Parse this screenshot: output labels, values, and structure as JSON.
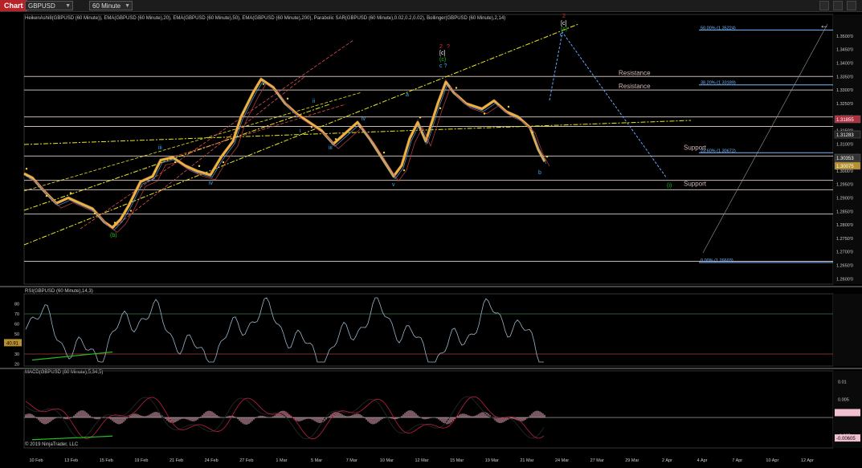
{
  "toolbar": {
    "chart_tab": "Chart",
    "instrument": "GBPUSD",
    "timeframe": "60 Minute"
  },
  "panels": {
    "price_title": "HeikenAshi8(GBPUSD (60 Minute)), EMA(GBPUSD (60 Minute),20), EMA(GBPUSD (60 Minute),50), EMA(GBPUSD (60 Minute),200), Parabolic SAR(GBPUSD (60 Minute),0.02,0.2,0.02), Bollinger(GBPUSD (60 Minute),2,14)",
    "rsi_title": "RSI(GBPUSD (60 Minute),14,3)",
    "macd_title": "MACD(GBPUSD (60 Minute),5,34,5)",
    "copyright": "© 2019 NinjaTrader, LLC"
  },
  "colors": {
    "background": "#000000",
    "candle": "#f0b040",
    "trend_yellow": "#e8e820",
    "trend_red": "#e05050",
    "level_line": "#e8d8d0",
    "fib_line": "#7ab8ff",
    "projection": "#6aa6ff",
    "rsi_line": "#9ab4c8",
    "macd_hist": "#f0b0c0",
    "green_line": "#20c020"
  },
  "chart_data": {
    "type": "line",
    "x_axis_labels": [
      "10 Feb",
      "13 Feb",
      "15 Feb",
      "19 Feb",
      "21 Feb",
      "24 Feb",
      "27 Feb",
      "1 Mar",
      "5 Mar",
      "7 Mar",
      "10 Mar",
      "12 Mar",
      "15 Mar",
      "19 Mar",
      "21 Mar",
      "24 Mar",
      "27 Mar",
      "29 Mar",
      "2 Apr",
      "4 Apr",
      "7 Apr",
      "10 Apr",
      "12 Apr"
    ],
    "price_axis_ticks": [
      "1.3500'0",
      "1.3450'0",
      "1.3400'0",
      "1.3350'0",
      "1.3300'0",
      "1.3250'0",
      "1.3200'0",
      "1.3150'0",
      "1.3100'0",
      "1.3050'0",
      "1.3000'0",
      "1.2950'0",
      "1.2900'0",
      "1.2850'0",
      "1.2800'0",
      "1.2750'0",
      "1.2700'0",
      "1.2650'0",
      "1.2600'0"
    ],
    "price_axis_range": [
      1.258,
      1.358
    ],
    "price_tags": [
      "1.31855",
      "1.31283",
      "1.30353",
      "1.30075"
    ],
    "horizontal_levels": [
      1.335,
      1.33,
      1.32,
      1.3165,
      1.3055,
      1.2965,
      1.293,
      1.284,
      1.2665
    ],
    "annotations": {
      "resistance_1": "Resistance",
      "resistance_2": "Resistance",
      "support_1": "Support",
      "support_2": "Support"
    },
    "fib_levels": [
      {
        "label": "50.00% (1.35224)",
        "value": 1.35224
      },
      {
        "label": "38.20% (1.33189)",
        "value": 1.33189
      },
      {
        "label": "23.60% (1.30672)",
        "value": 1.30672
      },
      {
        "label": "0.00% (1.26603)",
        "value": 1.26603
      }
    ],
    "wave_labels": [
      "(b)",
      "iii",
      "iv",
      "i",
      "ii",
      "iii",
      "iv",
      "v",
      "a",
      "b",
      "c",
      "(i)",
      "2",
      "?",
      "[c]",
      "(c)",
      "c ?",
      "c",
      "(c)",
      "[c]",
      "2"
    ],
    "rsi_axis_ticks": [
      "80",
      "70",
      "60",
      "50",
      "40",
      "30",
      "20"
    ],
    "rsi_axis_range": [
      18,
      90
    ],
    "rsi_levels": [
      70,
      30
    ],
    "rsi_current": "40.91",
    "macd_axis_ticks": [
      "0.01",
      "0.005",
      "0.00102",
      "-0.005"
    ],
    "macd_axis_range": [
      -0.0085,
      0.013
    ],
    "macd_current": "-0.00605"
  }
}
